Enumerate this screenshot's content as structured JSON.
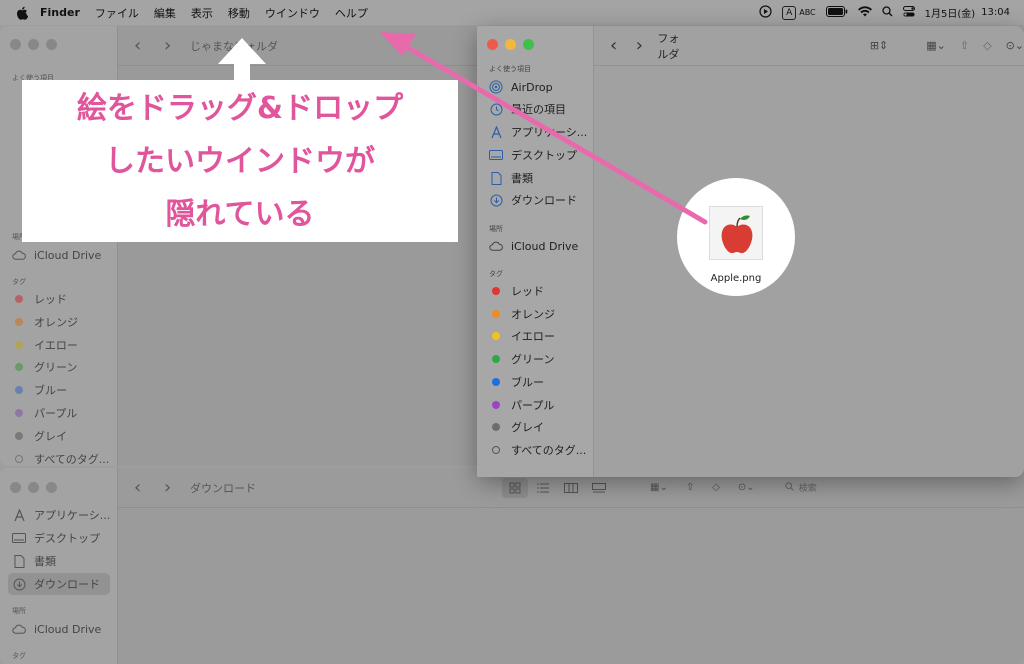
{
  "menubar": {
    "app_name": "Finder",
    "items": [
      "ファイル",
      "編集",
      "表示",
      "移動",
      "ウインドウ",
      "ヘルプ"
    ],
    "input_mode": "A",
    "input_label": "ABC",
    "date": "1月5日(金)",
    "time": "13:04"
  },
  "back_window": {
    "title": "じゃまなフォルダ",
    "favorites_header": "よく使う項目",
    "places_header": "場所",
    "icloud": "iCloud Drive",
    "tags_header": "タグ",
    "tags": [
      {
        "label": "レッド",
        "color": "#b36464"
      },
      {
        "label": "オレンジ",
        "color": "#b88858"
      },
      {
        "label": "イエロー",
        "color": "#b3a25b"
      },
      {
        "label": "グリーン",
        "color": "#6a9a6a"
      },
      {
        "label": "ブルー",
        "color": "#6a80ad"
      },
      {
        "label": "パープル",
        "color": "#8f76a3"
      },
      {
        "label": "グレイ",
        "color": "#7a7a7a"
      },
      {
        "label": "すべてのタグ...",
        "color": ""
      }
    ]
  },
  "bottom_window": {
    "title": "ダウンロード",
    "search_placeholder": "検索",
    "sidebar": [
      "アプリケーシ...",
      "デスクトップ",
      "書類",
      "ダウンロード"
    ],
    "places_header": "場所",
    "icloud": "iCloud Drive",
    "tags_header": "タグ"
  },
  "front_window": {
    "title": "フォルダ",
    "favorites_header": "よく使う項目",
    "favorites": [
      "AirDrop",
      "最近の項目",
      "アプリケーシ...",
      "デスクトップ",
      "書類",
      "ダウンロード"
    ],
    "places_header": "場所",
    "icloud": "iCloud Drive",
    "tags_header": "タグ",
    "tags": [
      {
        "label": "レッド",
        "color": "#e0362f"
      },
      {
        "label": "オレンジ",
        "color": "#f08b1f"
      },
      {
        "label": "イエロー",
        "color": "#f2c21a"
      },
      {
        "label": "グリーン",
        "color": "#2fa84a"
      },
      {
        "label": "ブルー",
        "color": "#1f6ee0"
      },
      {
        "label": "パープル",
        "color": "#9d45c5"
      },
      {
        "label": "グレイ",
        "color": "#6d6d6d"
      },
      {
        "label": "すべてのタグ...",
        "color": ""
      }
    ]
  },
  "callout": {
    "lines": [
      "絵をドラッグ&ドロップ",
      "したいウインドウが",
      "隠れている"
    ],
    "color": "#e0559b"
  },
  "file": {
    "name": "Apple.png"
  },
  "colors": {
    "arrow": "#e86aad",
    "up_arrow": "#ffffff"
  }
}
